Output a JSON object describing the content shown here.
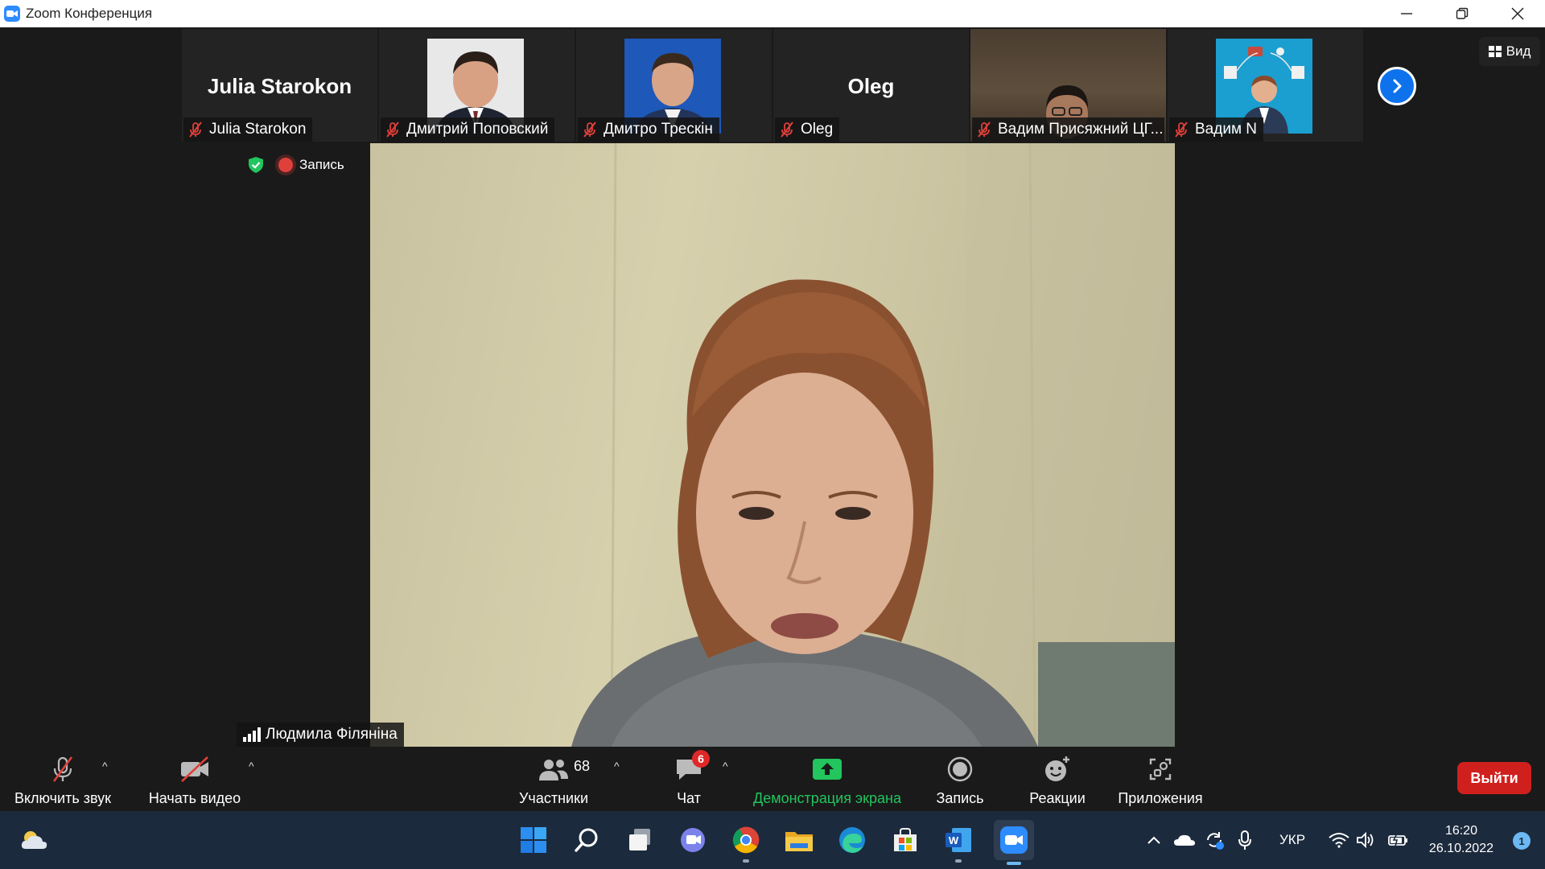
{
  "window": {
    "title": "Zoom Конференция",
    "minimize_icon": "minimize-icon",
    "restore_icon": "restore-icon",
    "close_icon": "close-icon"
  },
  "thumbnails": [
    {
      "name": "Julia Starokon",
      "display": "Julia Starokon",
      "type": "text",
      "muted": true
    },
    {
      "name": "Дмитрий Поповский",
      "type": "photo",
      "muted": true
    },
    {
      "name": "Дмитро Трескін",
      "type": "photo",
      "muted": true
    },
    {
      "name": "Oleg",
      "display": "Oleg",
      "type": "text",
      "muted": true
    },
    {
      "name": "Вадим Присяжний ЦГ...",
      "type": "video",
      "muted": true
    },
    {
      "name": "Вадим N",
      "type": "avatar",
      "muted": true
    }
  ],
  "view_button": {
    "label": "Вид"
  },
  "status": {
    "recording_label": "Запись"
  },
  "speaker": {
    "name": "Людмила Філяніна"
  },
  "toolbar": {
    "unmute_label": "Включить звук",
    "start_video_label": "Начать видео",
    "participants_label": "Участники",
    "participants_count": "68",
    "chat_label": "Чат",
    "chat_badge": "6",
    "share_label": "Демонстрация экрана",
    "record_label": "Запись",
    "reactions_label": "Реакции",
    "apps_label": "Приложения",
    "leave_label": "Выйти"
  },
  "colors": {
    "accent": "#2d8cff",
    "share_green": "#22c55e",
    "leave_red": "#d0201e",
    "muted_red": "#e0403a"
  },
  "taskbar": {
    "apps": [
      "start-icon",
      "search-icon",
      "task-view-icon",
      "teams-chat-icon",
      "chrome-icon",
      "file-explorer-icon",
      "edge-icon",
      "store-icon",
      "word-icon",
      "zoom-icon"
    ],
    "language": "УКР",
    "time": "16:20",
    "date": "26.10.2022",
    "notifications": "1"
  }
}
